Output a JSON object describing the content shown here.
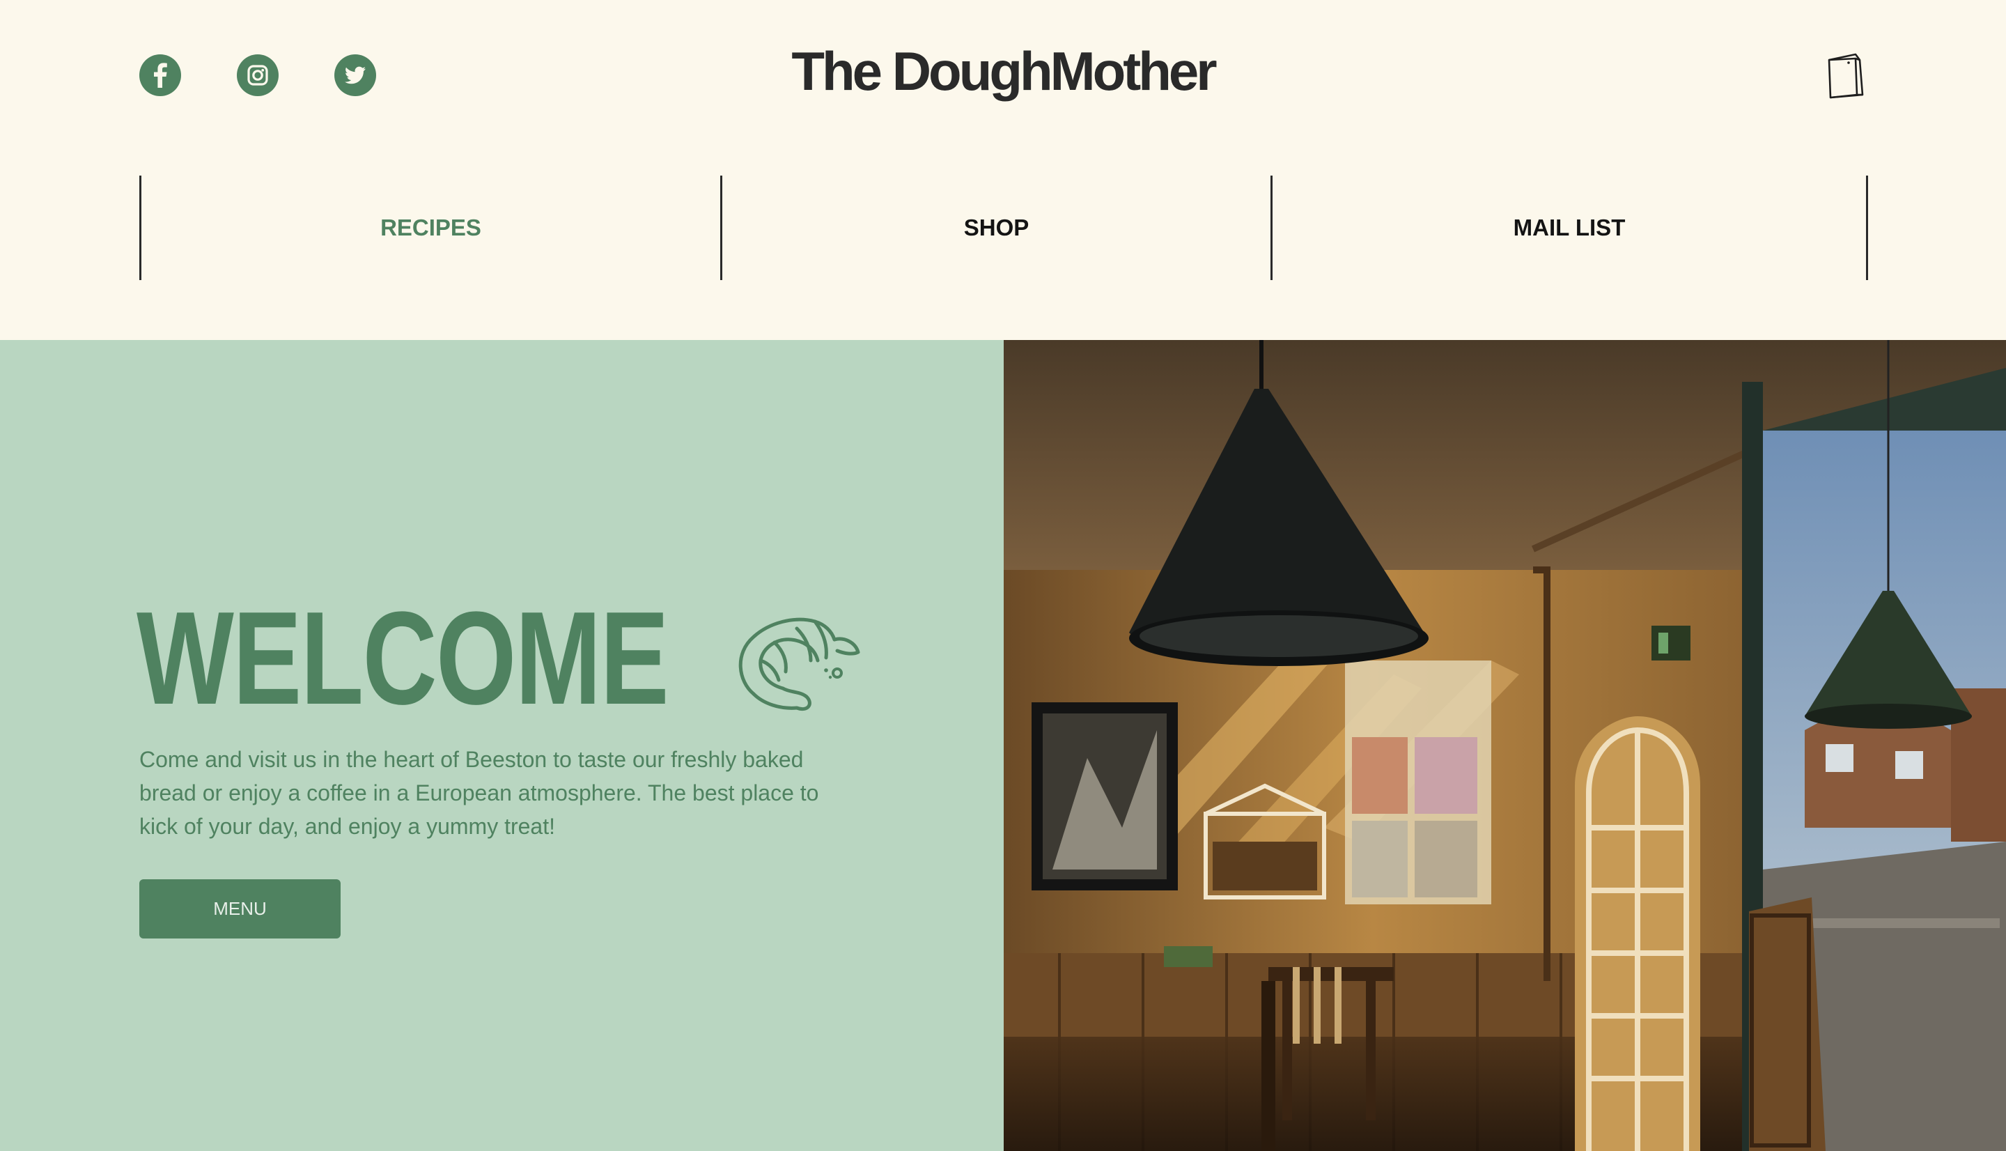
{
  "brand": {
    "name": "The DoughMother"
  },
  "social": [
    {
      "icon": "facebook-icon"
    },
    {
      "icon": "instagram-icon"
    },
    {
      "icon": "twitter-icon"
    }
  ],
  "cart": {
    "icon": "shopping-bag-icon"
  },
  "nav": {
    "items": [
      {
        "label": "RECIPES",
        "active": true
      },
      {
        "label": "SHOP",
        "active": false
      },
      {
        "label": "MAIL LIST",
        "active": false
      }
    ]
  },
  "hero": {
    "title": "WELCOME",
    "icon": "croissant-icon",
    "text": "Come and visit us in the heart of Beeston to taste our freshly baked bread or enjoy a coffee in a European atmosphere. The best place to kick of your day, and enjoy a yummy treat!",
    "button_label": "MENU",
    "image": "cafe-interior-photo"
  },
  "colors": {
    "accent": "#4f8260",
    "background": "#fcf8ec",
    "hero_panel": "#b9d6c1",
    "text_dark": "#141414"
  }
}
